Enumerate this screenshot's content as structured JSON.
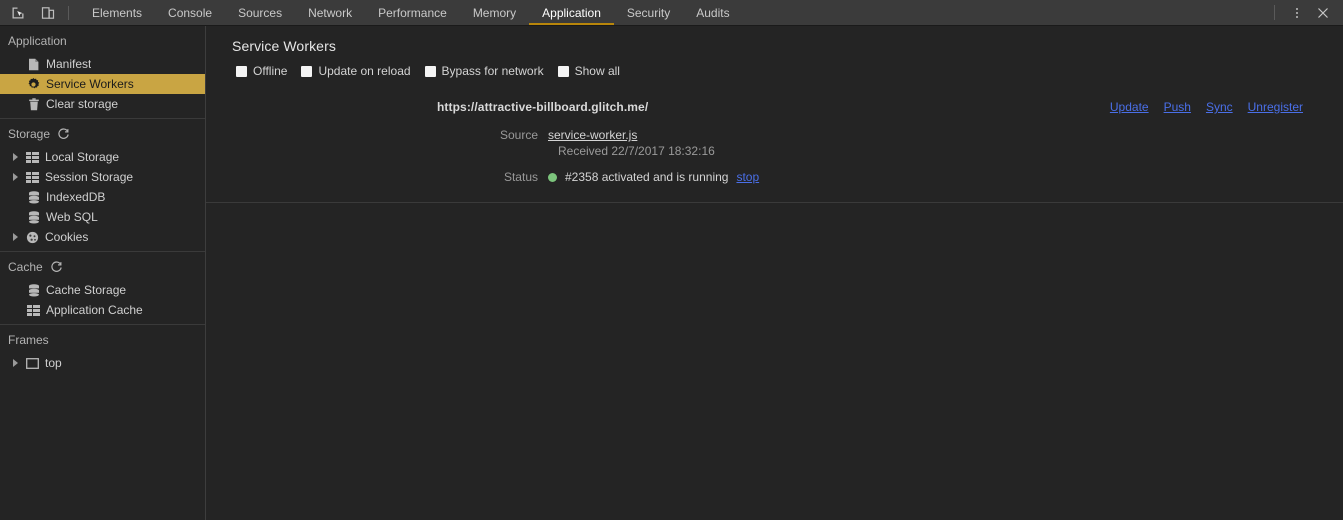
{
  "toolbar": {
    "left_icons": [
      {
        "name": "inspect-element-icon",
        "title": "Inspect element"
      },
      {
        "name": "device-toolbar-icon",
        "title": "Toggle device toolbar"
      }
    ],
    "tabs": [
      {
        "label": "Elements",
        "active": false
      },
      {
        "label": "Console",
        "active": false
      },
      {
        "label": "Sources",
        "active": false
      },
      {
        "label": "Network",
        "active": false
      },
      {
        "label": "Performance",
        "active": false
      },
      {
        "label": "Memory",
        "active": false
      },
      {
        "label": "Application",
        "active": true
      },
      {
        "label": "Security",
        "active": false
      },
      {
        "label": "Audits",
        "active": false
      }
    ],
    "more_menu_icon": "vertical-ellipsis-icon",
    "close_icon": "close-icon",
    "active_tab_underline_color": "#b8860b"
  },
  "sidebar": {
    "sections": [
      {
        "title": "Application",
        "has_refresh": false,
        "items": [
          {
            "label": "Manifest",
            "icon": "manifest-document-icon",
            "arrow": false,
            "selected": false
          },
          {
            "label": "Service Workers",
            "icon": "gear-icon",
            "arrow": false,
            "selected": true
          },
          {
            "label": "Clear storage",
            "icon": "trash-icon",
            "arrow": false,
            "selected": false
          }
        ]
      },
      {
        "title": "Storage",
        "has_refresh": true,
        "items": [
          {
            "label": "Local Storage",
            "icon": "table-icon",
            "arrow": true,
            "selected": false
          },
          {
            "label": "Session Storage",
            "icon": "table-icon",
            "arrow": true,
            "selected": false
          },
          {
            "label": "IndexedDB",
            "icon": "database-icon",
            "arrow": false,
            "selected": false
          },
          {
            "label": "Web SQL",
            "icon": "database-icon",
            "arrow": false,
            "selected": false
          },
          {
            "label": "Cookies",
            "icon": "cookie-icon",
            "arrow": true,
            "selected": false
          }
        ]
      },
      {
        "title": "Cache",
        "has_refresh": true,
        "items": [
          {
            "label": "Cache Storage",
            "icon": "database-icon",
            "arrow": false,
            "selected": false
          },
          {
            "label": "Application Cache",
            "icon": "table-icon",
            "arrow": false,
            "selected": false
          }
        ]
      },
      {
        "title": "Frames",
        "has_refresh": false,
        "items": [
          {
            "label": "top",
            "icon": "frame-icon",
            "arrow": true,
            "selected": false
          }
        ]
      }
    ],
    "selected_bg_color": "#c9a543"
  },
  "main": {
    "title": "Service Workers",
    "options": [
      {
        "label": "Offline",
        "checked": false
      },
      {
        "label": "Update on reload",
        "checked": false
      },
      {
        "label": "Bypass for network",
        "checked": false
      },
      {
        "label": "Show all",
        "checked": false
      }
    ],
    "registration": {
      "url": "https://attractive-billboard.glitch.me/",
      "actions": [
        "Update",
        "Push",
        "Sync",
        "Unregister"
      ],
      "source_label": "Source",
      "source_file": "service-worker.js",
      "received": "Received 22/7/2017 18:32:16",
      "status_label": "Status",
      "status_text": "#2358 activated and is running",
      "status_dot_color": "#7cc47c",
      "stop_label": "stop",
      "link_color": "#4a6fe8"
    }
  }
}
